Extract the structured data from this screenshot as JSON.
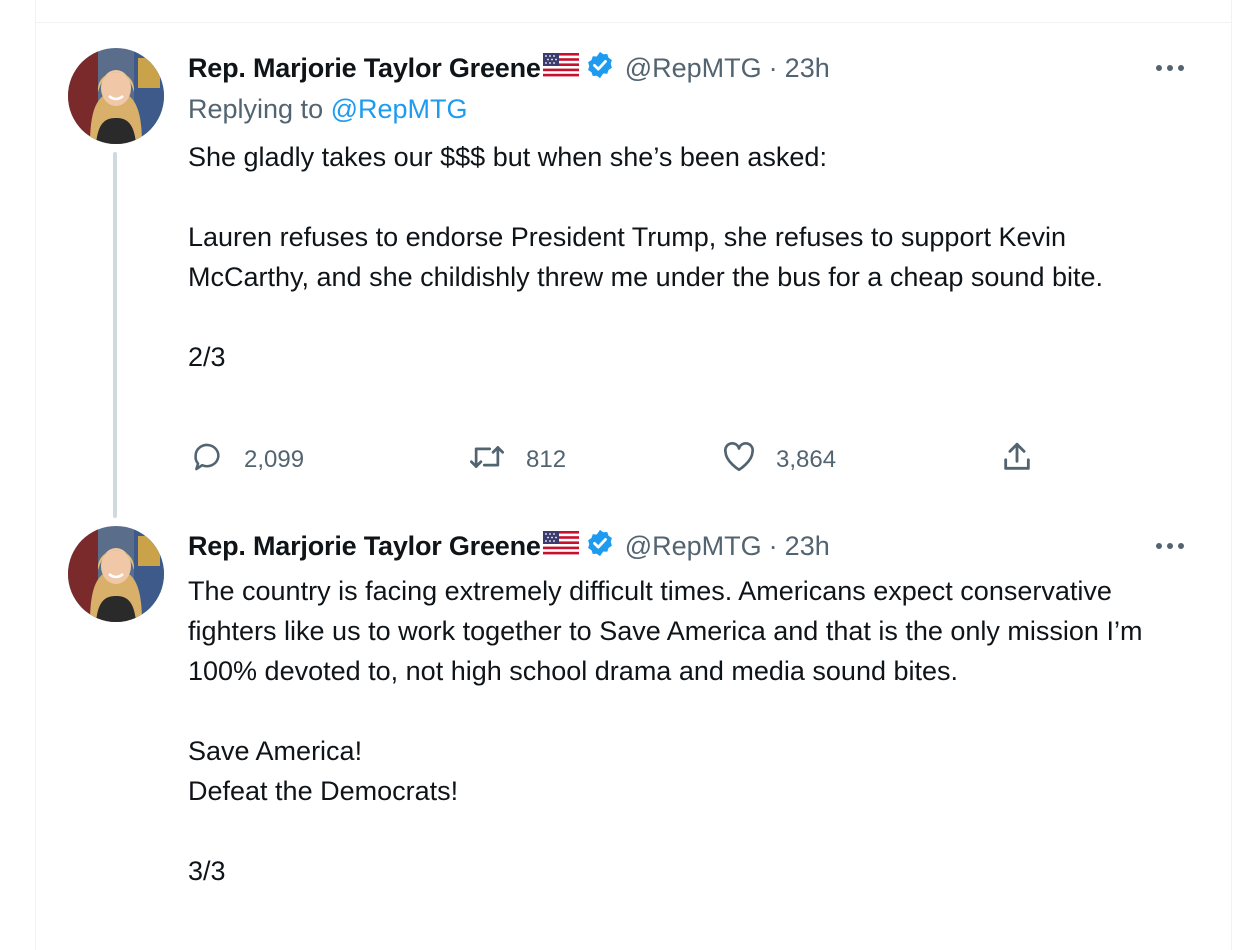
{
  "tweets": [
    {
      "author_name": "Rep. Marjorie Taylor Greene",
      "author_flag": "us-flag-icon",
      "handle": "@RepMTG",
      "separator": "·",
      "time": "23h",
      "replying_prefix": "Replying to",
      "replying_to": "@RepMTG",
      "paragraphs": [
        "She gladly takes our $$$ but when she’s been asked:",
        "Lauren refuses to endorse President Trump, she refuses to support Kevin McCarthy, and she childishly threw me under the bus for a cheap sound bite.",
        "2/3"
      ],
      "replies": "2,099",
      "retweets": "812",
      "likes": "3,864"
    },
    {
      "author_name": "Rep. Marjorie Taylor Greene",
      "author_flag": "us-flag-icon",
      "handle": "@RepMTG",
      "separator": "·",
      "time": "23h",
      "paragraphs": [
        "The country is facing extremely difficult times. Americans expect conservative fighters like us to work together to Save America and that is the only mission I’m 100% devoted to, not high school drama and media sound bites.",
        "Save America!\nDefeat the Democrats!",
        "3/3"
      ]
    }
  ],
  "colors": {
    "text": "#0f1419",
    "secondary": "#536471",
    "accent": "#1d9bf0",
    "thread_line": "#cfd9de"
  }
}
